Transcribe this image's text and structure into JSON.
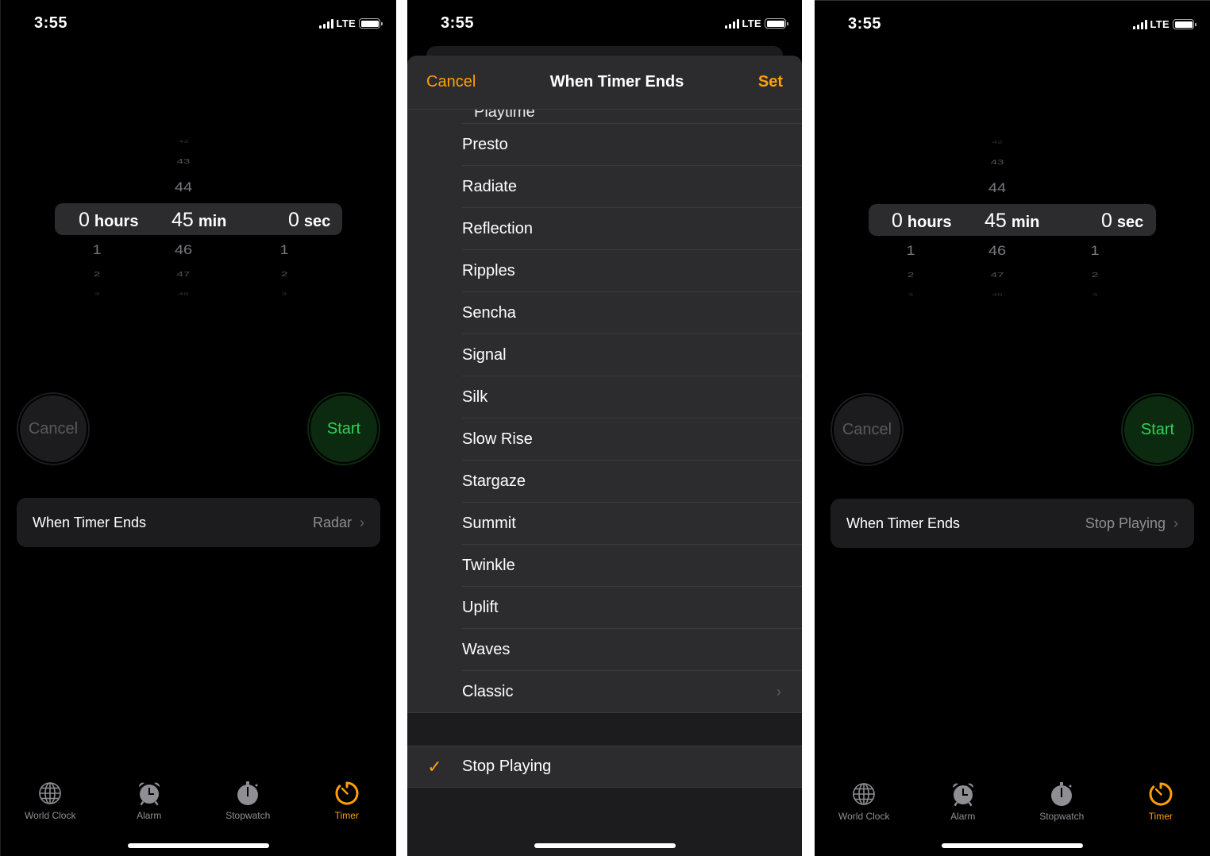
{
  "status_bar": {
    "time": "3:55",
    "network": "LTE"
  },
  "colors": {
    "accent": "#ff9f0a",
    "start_green": "#30d158",
    "secondary_text": "#8e8e93",
    "cell_bg": "#1c1c1e"
  },
  "screens": [
    {
      "picker": {
        "hours": {
          "above": [],
          "selected": "0",
          "unit": "hours",
          "below": [
            "1",
            "2",
            "3"
          ]
        },
        "minutes": {
          "above": [
            "42",
            "43",
            "44"
          ],
          "selected": "45",
          "unit": "min",
          "below": [
            "46",
            "47",
            "48"
          ]
        },
        "seconds": {
          "above": [],
          "selected": "0",
          "unit": "sec",
          "below": [
            "1",
            "2",
            "3"
          ]
        }
      },
      "buttons": {
        "cancel": "Cancel",
        "start": "Start"
      },
      "when_timer_ends": {
        "label": "When Timer Ends",
        "value": "Radar",
        "chevron": "chevron-right-icon"
      }
    },
    {
      "sheet": {
        "cancel": "Cancel",
        "title": "When Timer Ends",
        "set": "Set",
        "partial_item": "Playtime",
        "items": [
          "Presto",
          "Radiate",
          "Reflection",
          "Ripples",
          "Sencha",
          "Signal",
          "Silk",
          "Slow Rise",
          "Stargaze",
          "Summit",
          "Twinkle",
          "Uplift",
          "Waves",
          "Classic"
        ],
        "classic_has_chevron": true,
        "selected_option": "Stop Playing",
        "check_icon": "checkmark-icon"
      }
    },
    {
      "picker": {
        "hours": {
          "above": [],
          "selected": "0",
          "unit": "hours",
          "below": [
            "1",
            "2",
            "3"
          ]
        },
        "minutes": {
          "above": [
            "42",
            "43",
            "44"
          ],
          "selected": "45",
          "unit": "min",
          "below": [
            "46",
            "47",
            "48"
          ]
        },
        "seconds": {
          "above": [],
          "selected": "0",
          "unit": "sec",
          "below": [
            "1",
            "2",
            "3"
          ]
        }
      },
      "buttons": {
        "cancel": "Cancel",
        "start": "Start"
      },
      "when_timer_ends": {
        "label": "When Timer Ends",
        "value": "Stop Playing",
        "chevron": "chevron-right-icon"
      }
    }
  ],
  "tab_bar": {
    "tabs": [
      {
        "label": "World Clock",
        "icon": "globe-icon",
        "active": false
      },
      {
        "label": "Alarm",
        "icon": "alarm-clock-icon",
        "active": false
      },
      {
        "label": "Stopwatch",
        "icon": "stopwatch-icon",
        "active": false
      },
      {
        "label": "Timer",
        "icon": "timer-icon",
        "active": true
      }
    ]
  }
}
